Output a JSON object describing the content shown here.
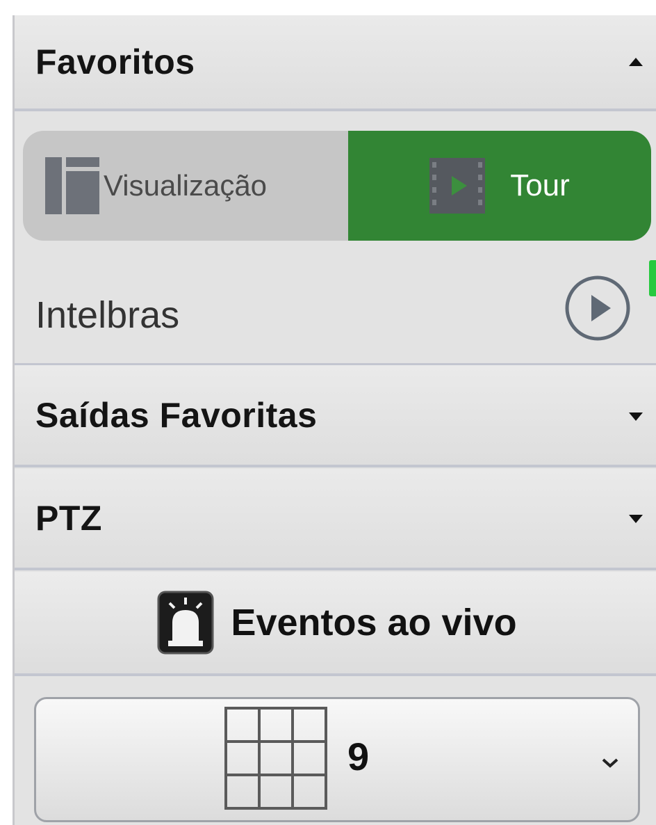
{
  "favoritos": {
    "title": "Favoritos",
    "tabs": {
      "visualizacao": "Visualização",
      "tour": "Tour"
    },
    "tour_items": [
      {
        "label": "Intelbras"
      }
    ]
  },
  "saidas_favoritas": {
    "title": "Saídas Favoritas"
  },
  "ptz": {
    "title": "PTZ"
  },
  "events": {
    "label": "Eventos ao vivo"
  },
  "layout": {
    "value": "9"
  },
  "colors": {
    "active_tab": "#328534",
    "panel_bg": "#e3e3e3",
    "accent_marker": "#27c93f"
  },
  "icons": {
    "visualizacao": "layout-icon",
    "tour": "film-play-icon",
    "play": "play-circle-icon",
    "events": "alarm-light-icon",
    "layout": "grid-3x3-icon"
  }
}
